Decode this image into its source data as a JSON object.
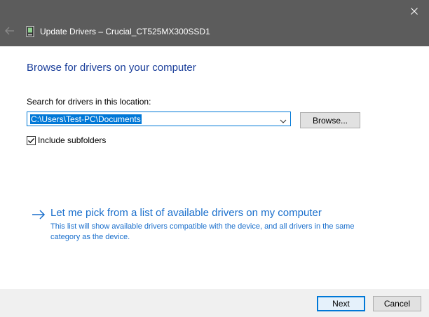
{
  "window": {
    "title": "Update Drivers – Crucial_CT525MX300SSD1"
  },
  "page": {
    "heading": "Browse for drivers on your computer",
    "search_label": "Search for drivers in this location:",
    "location_value": "C:\\Users\\Test-PC\\Documents",
    "browse_label": "Browse...",
    "include_subfolders_label": "Include subfolders",
    "include_subfolders_checked": true,
    "pick_link": "Let me pick from a list of available drivers on my computer",
    "pick_description": "This list will show available drivers compatible with the device, and all drivers in the same category as the device."
  },
  "footer": {
    "next_label": "Next",
    "cancel_label": "Cancel"
  },
  "icons": {
    "back": "back-arrow-icon",
    "device": "drive-icon",
    "close": "close-icon",
    "dropdown": "chevron-down-icon",
    "check": "checkmark-icon",
    "link_arrow": "right-arrow-icon"
  },
  "colors": {
    "titlebar": "#5c5c5c",
    "heading": "#1a3e9a",
    "link": "#1a6fcc",
    "accent": "#0078d7",
    "footer": "#f0f0f0"
  }
}
